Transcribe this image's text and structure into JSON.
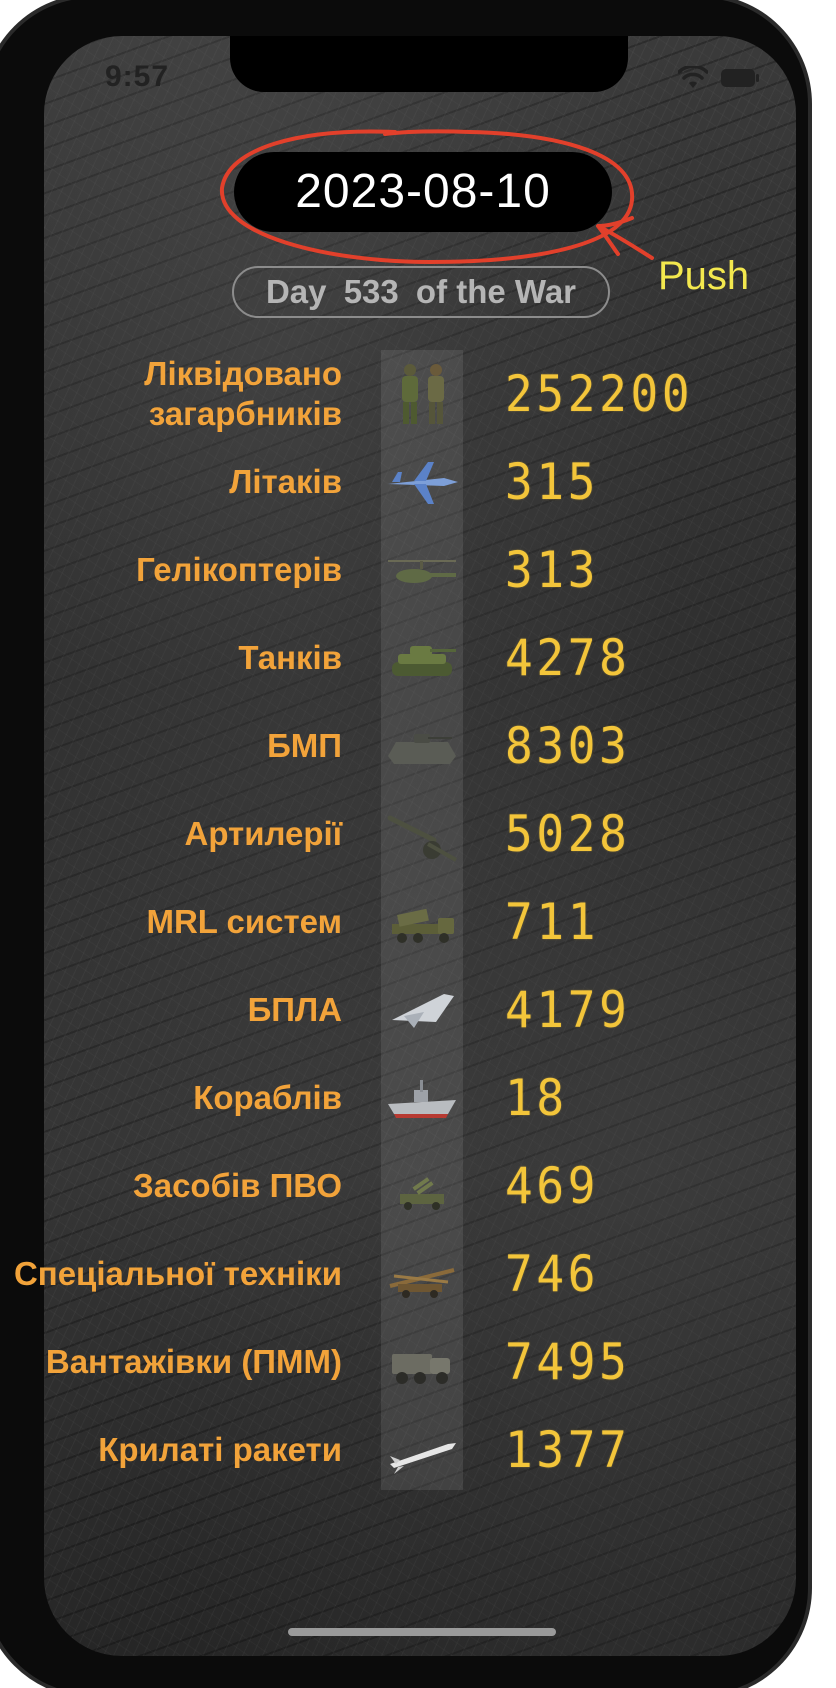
{
  "status_bar": {
    "time": "9:57",
    "wifi_icon": "wifi-icon",
    "battery_icon": "battery-icon"
  },
  "date_button": {
    "label": "2023-08-10"
  },
  "annotation": {
    "push_label": "Push",
    "color": "#e2402b",
    "text_color": "#f3e84e"
  },
  "day_counter": {
    "prefix": "Day",
    "number": "533",
    "suffix": "of the War"
  },
  "colors": {
    "label": "#f2a33a",
    "value": "#f3c53a"
  },
  "stats": [
    {
      "label": "Ліквідовано загарбників",
      "icon": "soldiers-icon",
      "value": "252200"
    },
    {
      "label": "Літаків",
      "icon": "jet-icon",
      "value": "315"
    },
    {
      "label": "Гелікоптерів",
      "icon": "helicopter-icon",
      "value": "313"
    },
    {
      "label": "Танків",
      "icon": "tank-icon",
      "value": "4278"
    },
    {
      "label": "БМП",
      "icon": "ifv-icon",
      "value": "8303"
    },
    {
      "label": "Артилерії",
      "icon": "artillery-icon",
      "value": "5028"
    },
    {
      "label": "MRL систем",
      "icon": "mrl-truck-icon",
      "value": "711"
    },
    {
      "label": "БПЛА",
      "icon": "drone-icon",
      "value": "4179"
    },
    {
      "label": "Кораблів",
      "icon": "ship-icon",
      "value": "18"
    },
    {
      "label": "Засобів ПВО",
      "icon": "air-defense-icon",
      "value": "469"
    },
    {
      "label": "Спеціальної техніки",
      "icon": "special-equipment-icon",
      "value": "746"
    },
    {
      "label": "Вантажівки (ПММ)",
      "icon": "truck-icon",
      "value": "7495"
    },
    {
      "label": "Крилаті ракети",
      "icon": "cruise-missile-icon",
      "value": "1377"
    }
  ]
}
